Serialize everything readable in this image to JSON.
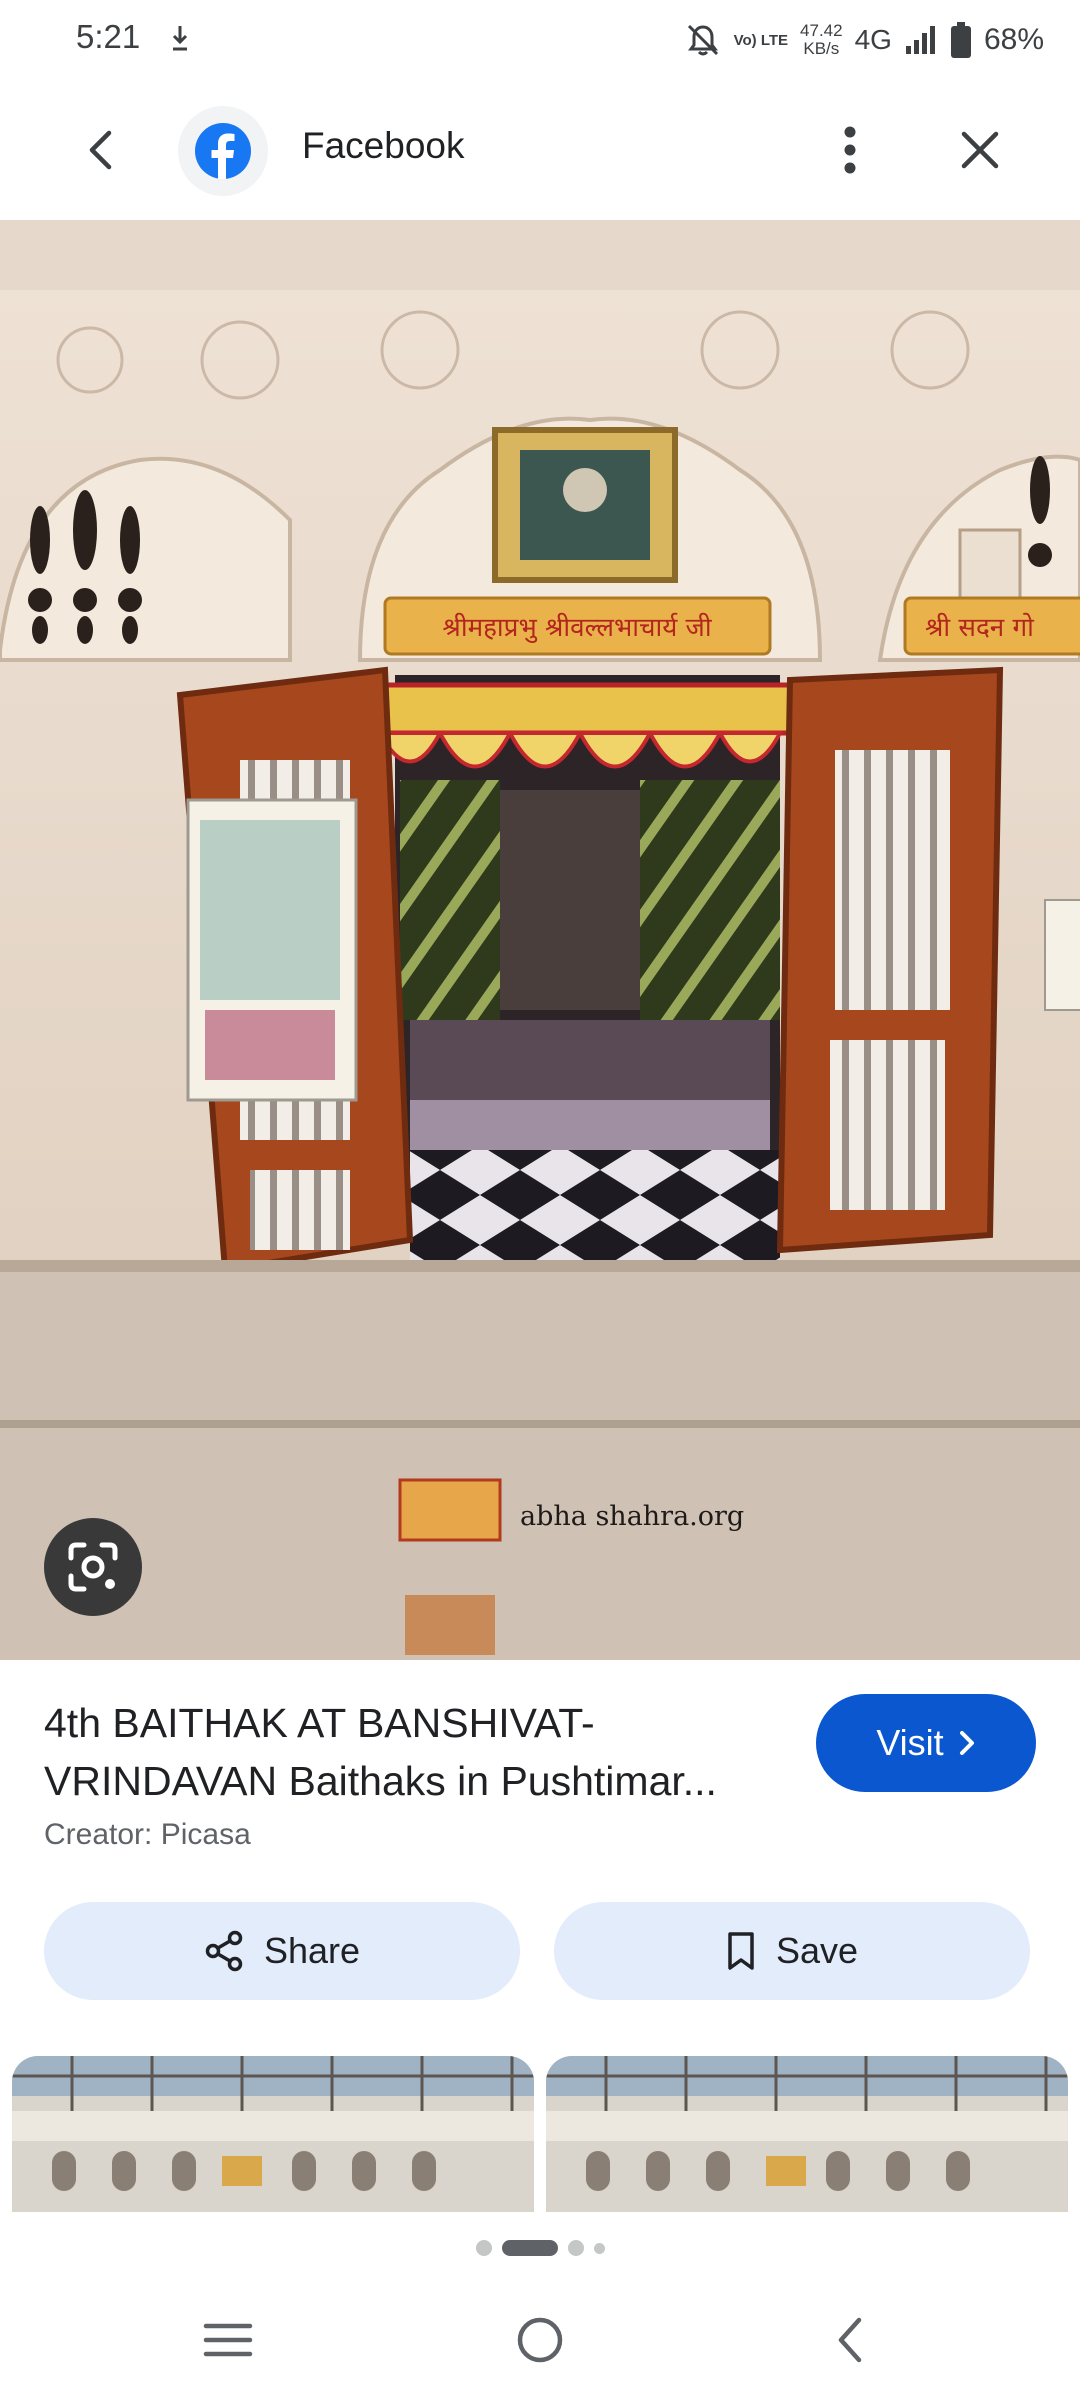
{
  "status_bar": {
    "time": "5:21",
    "volte": "Vo) LTE",
    "speed_value": "47.42",
    "speed_unit": "KB/s",
    "network": "4G",
    "battery": "68%"
  },
  "top_bar": {
    "site_name": "Facebook",
    "icons": [
      "back-arrow-icon",
      "facebook-logo",
      "more-vert-icon",
      "close-icon"
    ]
  },
  "main_image": {
    "watermark": "abha shahra.org",
    "signboard_left": "श्रीमहाप्रभु श्रीवल्लभाचार्य जी",
    "signboard_right": "श्री सदन गो"
  },
  "result": {
    "title_line1": "4th BAITHAK AT BANSHIVAT-",
    "title_line2": "VRINDAVAN Baithaks in Pushtimar...",
    "creator": "Creator: Picasa",
    "visit_label": "Visit"
  },
  "actions": {
    "share_label": "Share",
    "save_label": "Save"
  },
  "pager": {
    "count": 4,
    "active_index": 1
  },
  "colors": {
    "accent": "#0b57d0",
    "action_bg": "#e3ecfb"
  }
}
